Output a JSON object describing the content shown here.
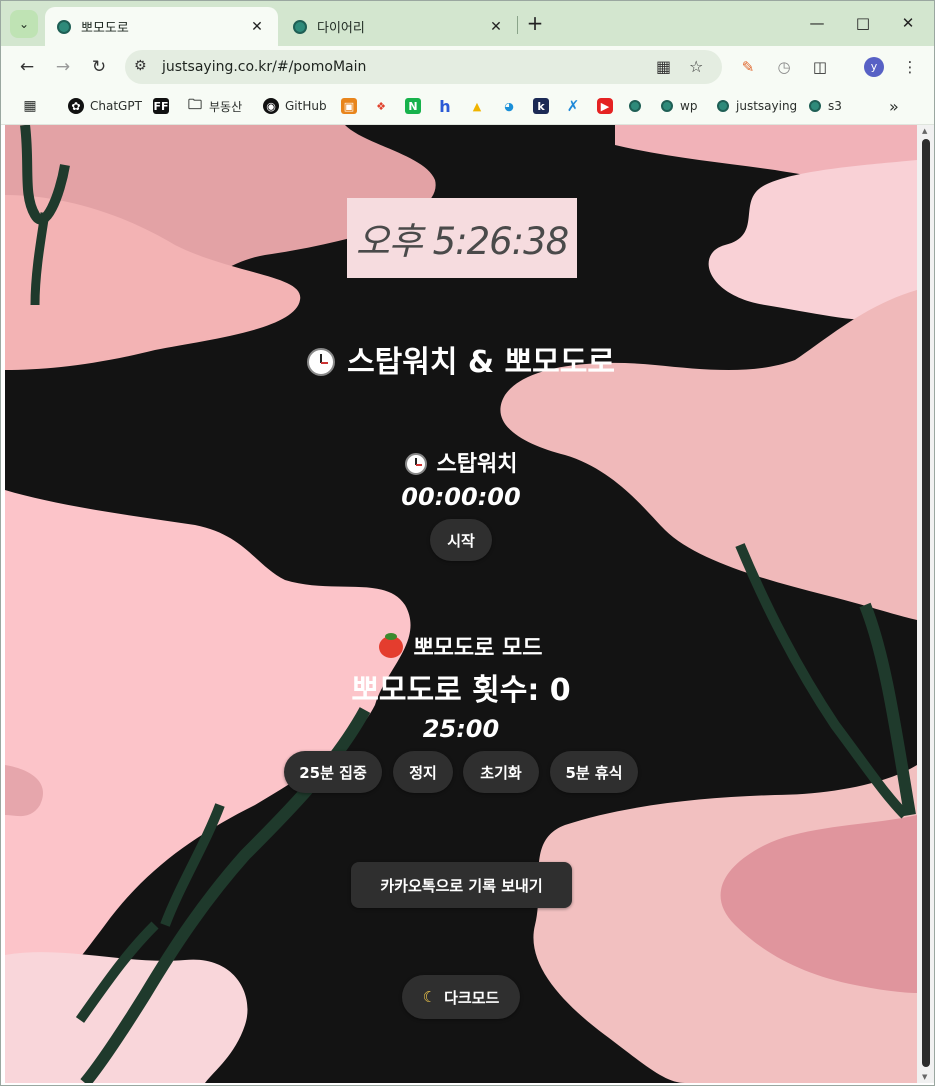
{
  "browser": {
    "tabs": [
      {
        "title": "뽀모도로",
        "active": true
      },
      {
        "title": "다이어리",
        "active": false
      }
    ],
    "new_tab_label": "+",
    "url": "justsaying.co.kr/#/pomoMain",
    "profile_initial": "y",
    "bookmarks": [
      "ChatGPT",
      "부동산",
      "GitHub",
      "wp",
      "justsaying",
      "s3"
    ],
    "bookmarks_more": "»"
  },
  "clock": {
    "time": "오후 5:26:38"
  },
  "main": {
    "title": "스탑워치 & 뽀모도로",
    "stopwatch": {
      "heading": "스탑워치",
      "time": "00:00:00",
      "start_label": "시작"
    },
    "pomodoro": {
      "heading": "뽀모도로 모드",
      "count_text": "뽀모도로 횟수: 0",
      "time": "25:00",
      "buttons": [
        "25분 집중",
        "정지",
        "초기화",
        "5분 휴식"
      ]
    },
    "kakao_label": "카카오톡으로 기록 보내기",
    "darkmode_label": "다크모드"
  },
  "colors": {
    "page_bg": "#131313",
    "pink_light": "#f9c3c8",
    "pink_mid": "#f1bcbc",
    "pink_dark": "#e0909a",
    "branch": "#1f3a2c",
    "button_bg": "#2f2f2f"
  }
}
